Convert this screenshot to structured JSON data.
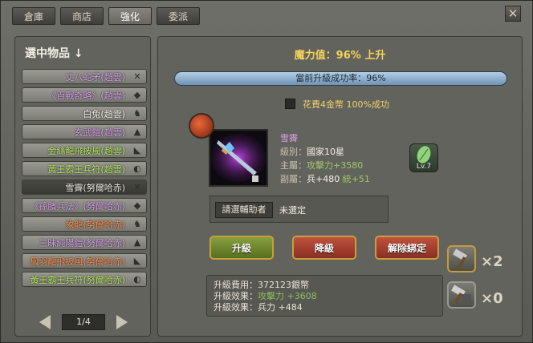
{
  "tabs": [
    {
      "label": "倉庫"
    },
    {
      "label": "商店"
    },
    {
      "label": "強化"
    },
    {
      "label": "委派"
    }
  ],
  "left_panel": {
    "title": "選中物品",
    "items": [
      {
        "name": "丈八蛇矛(趙雲)",
        "color": "purple",
        "icon": "crossed-swords-icon"
      },
      {
        "name": "《百戰奇略》(趙雲)",
        "color": "purple",
        "icon": "book-icon"
      },
      {
        "name": "白兔(趙雲)",
        "color": "white",
        "icon": "horse-icon"
      },
      {
        "name": "玄武鎧(趙雲)",
        "color": "purple",
        "icon": "armor-icon"
      },
      {
        "name": "金絲龍飛披風(趙雲)",
        "color": "green",
        "icon": "cloak-icon"
      },
      {
        "name": "黃王霸王兵符(趙雲)",
        "color": "green",
        "icon": "token-icon"
      },
      {
        "name": "雪霽(努爾哈赤)",
        "color": "white",
        "icon": "crossed-swords-icon"
      },
      {
        "name": "《孫臏兵法》(努爾哈赤)",
        "color": "purple",
        "icon": "book-icon"
      },
      {
        "name": "象龍(努爾哈赤)",
        "color": "orange",
        "icon": "horse-icon"
      },
      {
        "name": "三昧純陽鎧(努爾哈赤)",
        "color": "purple",
        "icon": "armor-icon"
      },
      {
        "name": "鳳羽龍飛披風(努爾哈赤)",
        "color": "orange",
        "icon": "cloak-icon"
      },
      {
        "name": "黃王霸王兵符(努爾哈赤)",
        "color": "green",
        "icon": "token-icon"
      }
    ],
    "selected_index": 6,
    "page": "1/4"
  },
  "enhance": {
    "mana_label": "魔力值：96% 上升",
    "rate_label": "當前升級成功率：96%",
    "rate_value": 0.96,
    "guarantee_label": "花費4金幣 100%成功",
    "item": {
      "name": "雪霽",
      "level_label": "級別：",
      "level_value": "國家10星",
      "main_label": "主屬：",
      "main_value": "攻擊力+3580",
      "sub_label": "副屬：",
      "sub_value_a": "兵+480",
      "sub_value_b": "統+51"
    },
    "gem_level": "Lv.7",
    "assist_button": "請選輔助者",
    "assist_value": "未選定",
    "buttons": {
      "upgrade": "升級",
      "downgrade": "降級",
      "unbind": "解除綁定"
    },
    "cost": {
      "line1_label": "升級費用：",
      "line1_value": "372123銀幣",
      "line2_label": "升級效果：",
      "line2_value": "攻擊力 +3608",
      "line3_label": "升級效果：",
      "line3_value": "兵力 +484"
    },
    "tools": [
      {
        "icon": "hammer-icon",
        "count": "×2"
      },
      {
        "icon": "double-hammer-icon",
        "count": "×0"
      }
    ]
  },
  "colors": {
    "purple": "#d7a0e8",
    "green": "#b8e860",
    "orange": "#ff9050",
    "white": "#f4f0e6",
    "gold": "#f4d35a"
  }
}
